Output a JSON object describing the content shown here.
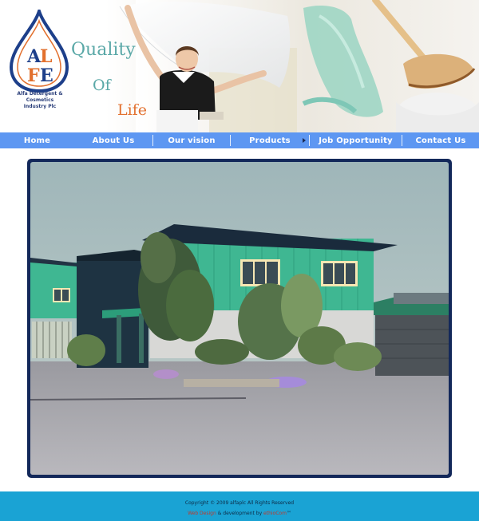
{
  "brand": {
    "logo_letters": "ALFE",
    "tagline_line1": "Alfa Detergent & Cosmetics",
    "tagline_line2": "Industry Plc",
    "slogan_word1": "Quality",
    "slogan_word2": "Of",
    "slogan_word3": "Life",
    "colors": {
      "logo_blue": "#1d3f8a",
      "logo_orange": "#e2702e",
      "slogan_teal": "#5aa8a7"
    }
  },
  "nav": {
    "items": [
      {
        "label": "Home"
      },
      {
        "label": "About Us"
      },
      {
        "label": "Our vision"
      },
      {
        "label": "Products"
      },
      {
        "label": "Job Opportunity"
      },
      {
        "label": "Contact Us"
      }
    ],
    "bar_color": "#5d97f2"
  },
  "footer": {
    "copyright": "Copyright © 2009 alfaplc All Rights Reserved",
    "credit_design": "Web Design",
    "credit_middle": " & development by ",
    "credit_dev": "ethioCom",
    "credit_tail": "™",
    "bg_color": "#1aa3d4"
  }
}
